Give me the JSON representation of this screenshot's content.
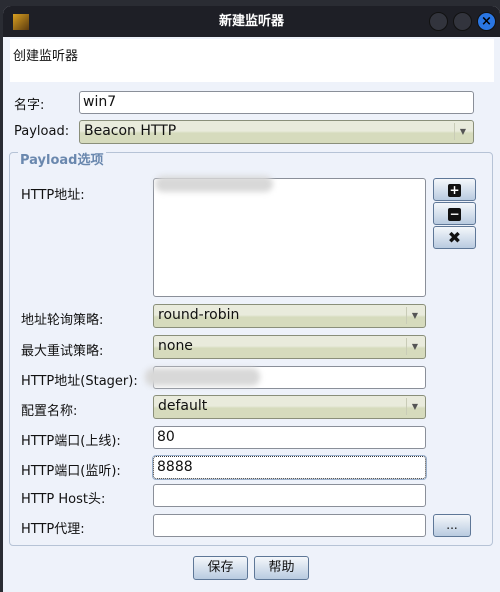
{
  "window": {
    "title": "新建监听器"
  },
  "header": {
    "text": "创建监听器"
  },
  "form": {
    "name_label": "名字:",
    "name_value": "win7",
    "payload_label": "Payload:",
    "payload_value": "Beacon HTTP",
    "group_title": "Payload选项",
    "hosts_label": "HTTP地址:",
    "rotate_label": "地址轮询策略:",
    "rotate_value": "round-robin",
    "retry_label": "最大重试策略:",
    "retry_value": "none",
    "stager_label": "HTTP地址(Stager):",
    "profile_label": "配置名称:",
    "profile_value": "default",
    "port_bind_label": "HTTP端口(上线):",
    "port_bind_value": "80",
    "port_listen_label": "HTTP端口(监听):",
    "port_listen_value": "8888",
    "host_header_label": "HTTP Host头:",
    "host_header_value": "",
    "proxy_label": "HTTP代理:",
    "proxy_value": "",
    "proxy_button": "..."
  },
  "buttons": {
    "add": "+",
    "remove": "−",
    "clear": "✖",
    "save": "保存",
    "help": "帮助"
  }
}
